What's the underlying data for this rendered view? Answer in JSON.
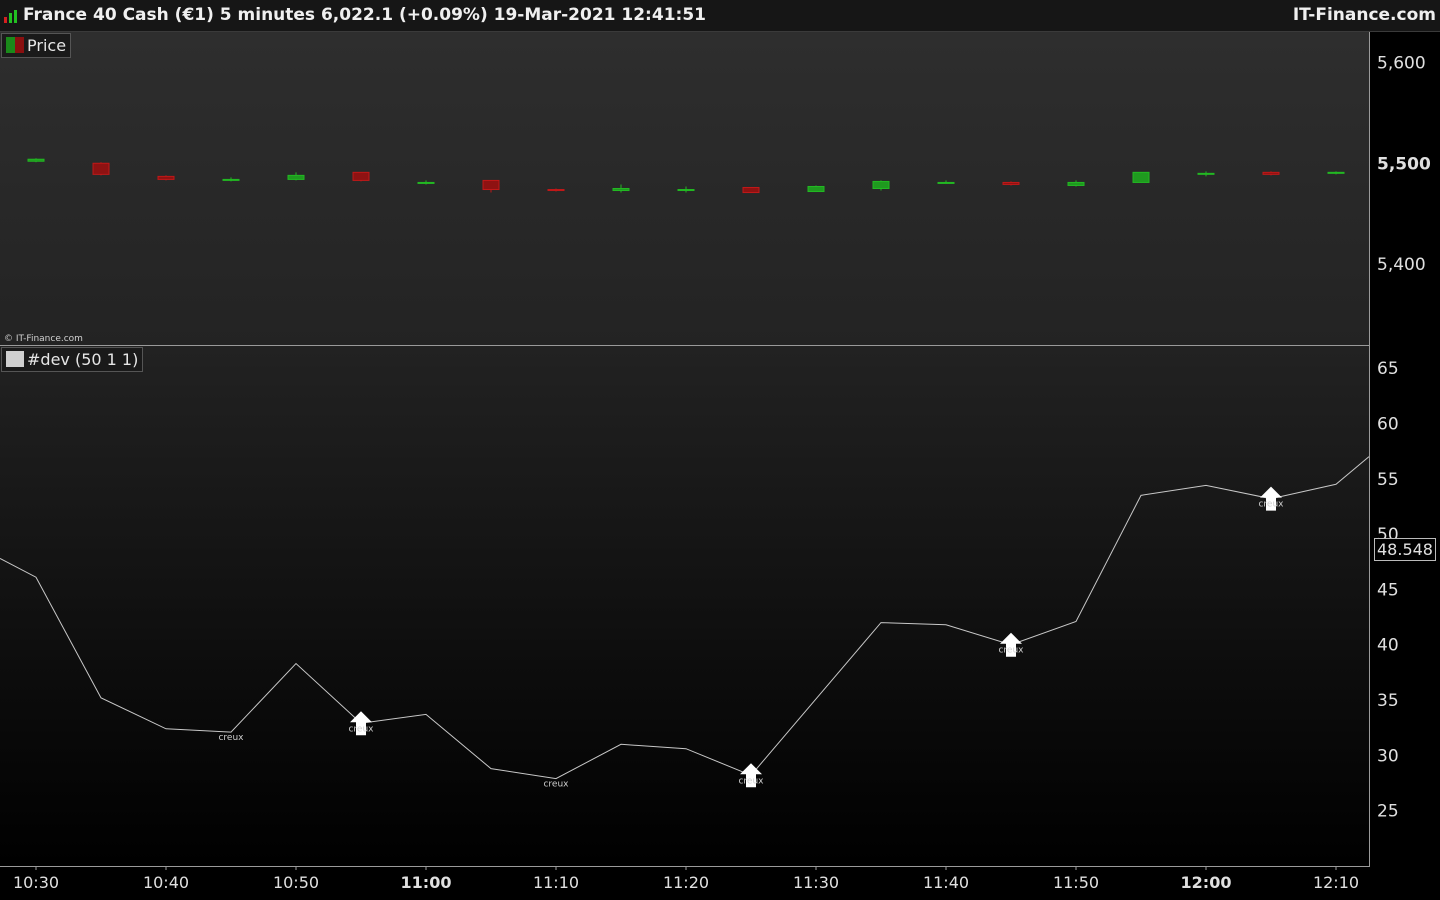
{
  "header": {
    "title": "France 40 Cash (€1) 5 minutes 6,022.1 (+0.09%) 19-Mar-2021 12:41:51",
    "brand": "IT-Finance.com"
  },
  "price_panel": {
    "legend": "Price",
    "copyright": "© IT-Finance.com"
  },
  "dev_panel": {
    "legend": "#dev (50 1 1)",
    "last_value": "48.548"
  },
  "colors": {
    "up": "#22b822",
    "down": "#c01818",
    "line": "#c8c8c8",
    "arrow": "#ffffff"
  },
  "chart_data": [
    {
      "type": "candlestick",
      "title": "Price",
      "ylim": [
        5320,
        5630
      ],
      "yticks": [
        "5,600",
        "5,500",
        "5,400"
      ],
      "ytick_values": [
        5600,
        5500,
        5400
      ],
      "ytick_bold": [
        false,
        true,
        false
      ],
      "x": [
        "10:30",
        "10:35",
        "10:40",
        "10:45",
        "10:50",
        "10:55",
        "11:00",
        "11:05",
        "11:10",
        "11:15",
        "11:20",
        "11:25",
        "11:30",
        "11:35",
        "11:40",
        "11:45",
        "11:50",
        "11:55",
        "12:00",
        "12:05",
        "12:10"
      ],
      "open": [
        5502,
        5500,
        5487,
        5484,
        5484,
        5491,
        5481,
        5483,
        5474,
        5473,
        5474,
        5476,
        5472,
        5475,
        5481,
        5481,
        5478,
        5481,
        5490,
        5491,
        5490
      ],
      "close": [
        5504,
        5489,
        5484,
        5484,
        5488,
        5483,
        5481,
        5474,
        5473,
        5475,
        5474,
        5471,
        5477,
        5482,
        5481,
        5479,
        5481,
        5491,
        5490,
        5489,
        5491
      ],
      "high": [
        5505,
        5501,
        5488,
        5486,
        5491,
        5491,
        5483,
        5483,
        5475,
        5479,
        5477,
        5476,
        5478,
        5483,
        5483,
        5482,
        5483,
        5491,
        5492,
        5492,
        5492
      ],
      "low": [
        5501,
        5488,
        5483,
        5482,
        5483,
        5482,
        5479,
        5471,
        5472,
        5471,
        5471,
        5471,
        5472,
        5473,
        5480,
        5478,
        5477,
        5481,
        5487,
        5488,
        5489
      ]
    },
    {
      "type": "line",
      "title": "#dev (50 1 1)",
      "ylim": [
        20,
        67
      ],
      "yticks": [
        "65",
        "60",
        "55",
        "50",
        "45",
        "40",
        "35",
        "30",
        "25"
      ],
      "ytick_values": [
        65,
        60,
        55,
        50,
        45,
        40,
        35,
        30,
        25
      ],
      "x": [
        "10:25",
        "10:30",
        "10:35",
        "10:40",
        "10:45",
        "10:50",
        "10:55",
        "11:00",
        "11:05",
        "11:10",
        "11:15",
        "11:20",
        "11:25",
        "11:30",
        "11:35",
        "11:40",
        "11:45",
        "11:50",
        "11:55",
        "12:00",
        "12:05",
        "12:10",
        "12:15"
      ],
      "values": [
        47.8,
        46.1,
        35.2,
        32.4,
        32.1,
        38.3,
        32.9,
        33.7,
        28.8,
        27.9,
        31.0,
        30.6,
        28.2,
        35.1,
        42.0,
        41.8,
        40.0,
        42.1,
        53.5,
        54.4,
        53.2,
        54.5,
        57.0
      ],
      "signals": [
        {
          "x": "10:45",
          "label": "creux",
          "arrow": false
        },
        {
          "x": "10:55",
          "label": "creux",
          "arrow": true
        },
        {
          "x": "11:10",
          "label": "creux",
          "arrow": false
        },
        {
          "x": "11:25",
          "label": "creux",
          "arrow": true
        },
        {
          "x": "11:45",
          "label": "creux",
          "arrow": true
        },
        {
          "x": "12:05",
          "label": "creux",
          "arrow": true
        }
      ]
    }
  ],
  "time_axis": {
    "labels": [
      "10:30",
      "10:40",
      "10:50",
      "11:00",
      "11:10",
      "11:20",
      "11:30",
      "11:40",
      "11:50",
      "12:00",
      "12:10"
    ],
    "bold": [
      false,
      false,
      false,
      true,
      false,
      false,
      false,
      false,
      false,
      true,
      false
    ]
  }
}
